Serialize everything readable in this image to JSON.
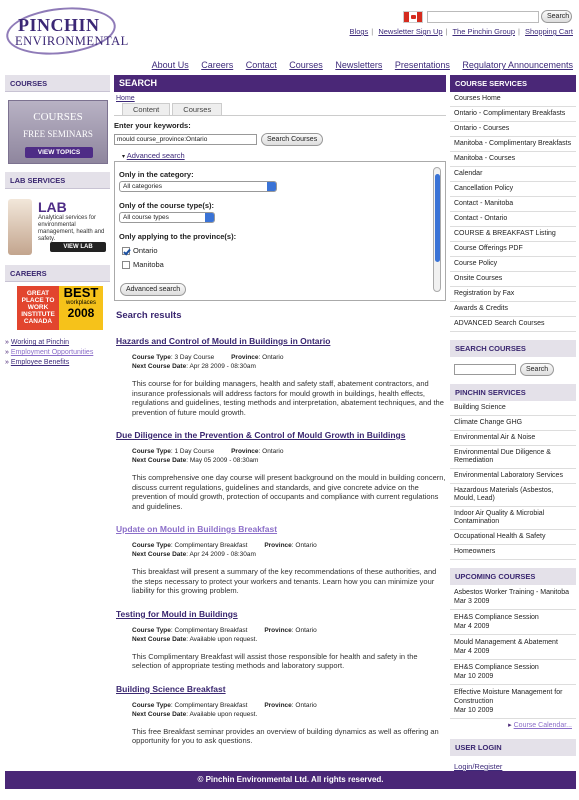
{
  "header": {
    "logo_line1": "PINCHIN",
    "logo_line2": "ENVIRONMENTAL",
    "top_search_button": "Search",
    "top_links": [
      "Blogs",
      "Newsletter Sign Up",
      "The Pinchin Group",
      "Shopping Cart"
    ],
    "nav": [
      "About Us",
      "Careers",
      "Contact",
      "Courses",
      "Newsletters",
      "Presentations",
      "Regulatory Announcements"
    ]
  },
  "left": {
    "courses_head": "COURSES",
    "courses_banner": {
      "line1": "COURSES",
      "line2": "FREE SEMINARS",
      "button": "VIEW TOPICS"
    },
    "lab_head": "LAB SERVICES",
    "lab_banner": {
      "title": "LAB",
      "text": "Analytical services for environmental management, health and safety.",
      "button": "VIEW LAB"
    },
    "careers_head": "CAREERS",
    "careers_banner": {
      "a": "GREAT PLACE TO WORK INSTITUTE CANADA",
      "b1": "BEST",
      "b2": "workplaces",
      "b3": "2008"
    },
    "career_links": [
      "Working at Pinchin",
      "Employment Opportunities",
      "Employee Benefits"
    ]
  },
  "main": {
    "page_title": "SEARCH",
    "breadcrumb": "Home",
    "tabs": [
      "Content",
      "Courses"
    ],
    "keywords_label": "Enter your keywords:",
    "keywords_value": "mould course_province:Ontario",
    "search_courses_button": "Search Courses",
    "advanced_toggle": "Advanced search",
    "category_label": "Only in the category:",
    "category_value": "All categories",
    "type_label": "Only of the course type(s):",
    "type_value": "All course types",
    "province_label": "Only applying to the province(s):",
    "provinces": [
      {
        "label": "Ontario",
        "checked": true
      },
      {
        "label": "Manitoba",
        "checked": false
      }
    ],
    "advanced_button": "Advanced search",
    "results_title": "Search results",
    "results": [
      {
        "title": "Hazards and Control of Mould in Buildings in Ontario",
        "type": "3 Day Course",
        "province": "Ontario",
        "next": "Apr 28 2009 - 08:30am",
        "desc": "This course for for building managers, health and safety staff, abatement contractors, and insurance professionals will address factors for mould growth in buildings, health effects, regulations and guidelines, testing methods and interpretation, abatement techniques, and the prevention of future mould growth.",
        "visited": false
      },
      {
        "title": "Due Diligence in the Prevention & Control of Mould Growth in Buildings",
        "type": "1 Day Course",
        "province": "Ontario",
        "next": "May 05 2009 - 08:30am",
        "desc": "This comprehensive one day course will present background on the mould in building concern, discuss current regulations, guidelines and standards, and give concrete advice on the prevention of mould growth, protection of occupants and compliance with current regulations and guidelines.",
        "visited": false
      },
      {
        "title": "Update on Mould in Buildings Breakfast",
        "type": "Complimentary Breakfast",
        "province": "Ontario",
        "next": "Apr 24 2009 - 08:30am",
        "desc": "This breakfast will present a summary of the key recommendations of these authorities, and the steps necessary to protect your workers and tenants. Learn how you can minimize your liability for this growing problem.",
        "visited": true
      },
      {
        "title": "Testing for Mould in Buildings",
        "type": "Complimentary Breakfast",
        "province": "Ontario",
        "next": "Available upon request.",
        "desc": "This Complimentary Breakfast will assist those responsible for health and safety in the selection of appropriate testing methods and laboratory support.",
        "visited": false
      },
      {
        "title": "Building Science Breakfast",
        "type": "Complimentary Breakfast",
        "province": "Ontario",
        "next": "Available upon request.",
        "desc": "This free Breakfast seminar provides an overview of building dynamics as well as offering an opportunity for you to ask questions.",
        "visited": false
      }
    ],
    "labels": {
      "course_type": "Course Type",
      "province": "Province",
      "next_date": "Next Course Date"
    }
  },
  "right": {
    "course_services_head": "COURSE SERVICES",
    "course_services": [
      "Courses Home",
      "Ontario - Complimentary Breakfasts",
      "Ontario - Courses",
      "Manitoba - Complimentary Breakfasts",
      "Manitoba - Courses",
      "Calendar",
      "Cancellation Policy",
      "Contact - Manitoba",
      "Contact - Ontario",
      "COURSE & BREAKFAST Listing",
      "Course Offerings PDF",
      "Course Policy",
      "Onsite Courses",
      "Registration by Fax",
      "Awards & Credits",
      "ADVANCED Search Courses"
    ],
    "search_head": "SEARCH COURSES",
    "search_button": "Search",
    "services_head": "PINCHIN SERVICES",
    "services": [
      "Building Science",
      "Climate Change GHG",
      "Environmental Air & Noise",
      "Environmental Due Diligence & Remediation",
      "Environmental Laboratory Services",
      "Hazardous Materials (Asbestos, Mould, Lead)",
      "Indoor Air Quality & Microbial Contamination",
      "Occupational Health & Safety",
      "Homeowners"
    ],
    "upcoming_head": "UPCOMING COURSES",
    "upcoming": [
      {
        "name": "Asbestos Worker Training - Manitoba",
        "date": "Mar 3 2009"
      },
      {
        "name": "EH&S Compliance Session",
        "date": "Mar 4 2009"
      },
      {
        "name": "Mould Management & Abatement",
        "date": "Mar 4 2009"
      },
      {
        "name": "EH&S Compliance Session",
        "date": "Mar 10 2009"
      },
      {
        "name": "Effective Moisture Management for Construction",
        "date": "Mar 10 2009"
      }
    ],
    "calendar_link": "Course Calendar...",
    "login_head": "USER LOGIN",
    "login_link": "Login/Register"
  },
  "footer": "© Pinchin Environmental Ltd. All rights reserved.",
  "colors": {
    "brand_purple": "#4a2777",
    "side_header_bg": "#e4e1e9",
    "link": "#3d2a7a"
  }
}
